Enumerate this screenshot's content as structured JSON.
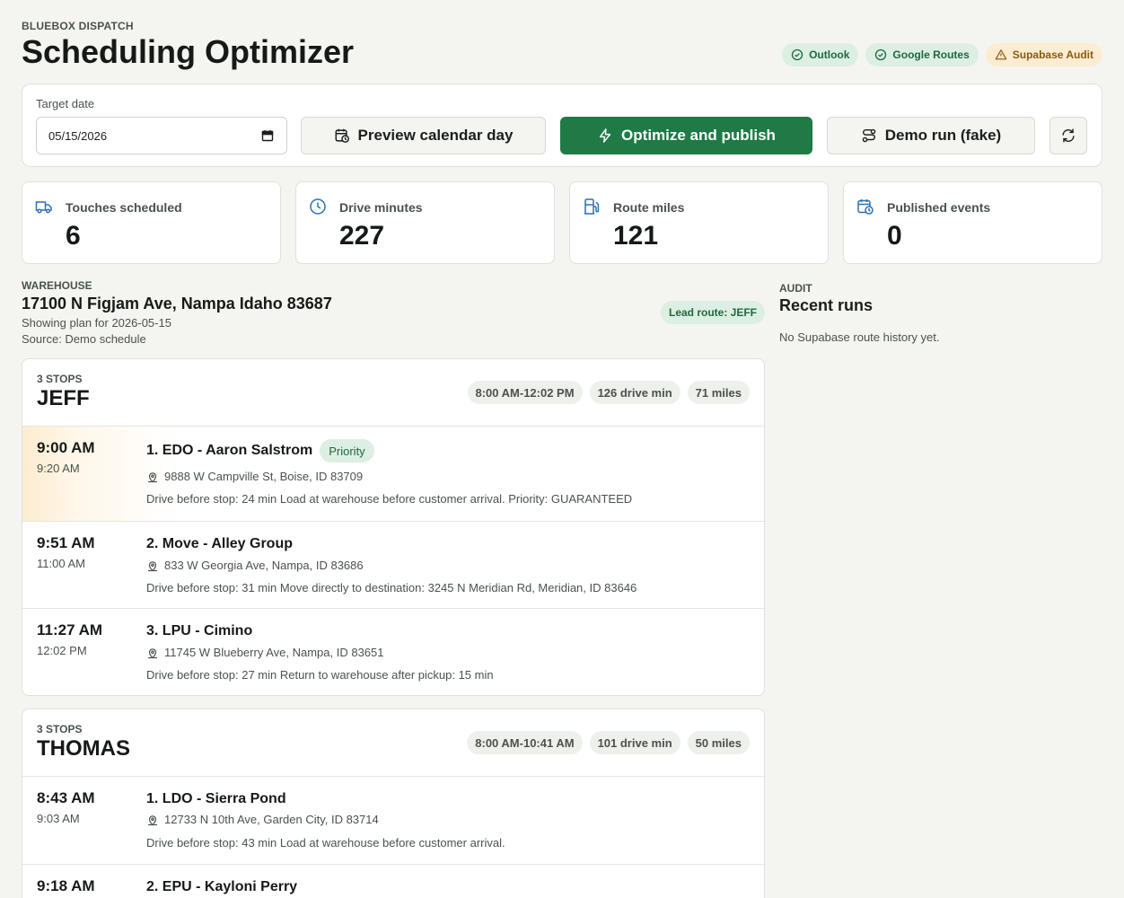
{
  "header": {
    "eyebrow": "BLUEBOX DISPATCH",
    "title": "Scheduling Optimizer",
    "badges": [
      {
        "label": "Outlook",
        "icon": "check-circle-icon"
      },
      {
        "label": "Google Routes",
        "icon": "check-circle-icon"
      },
      {
        "label": "Supabase Audit",
        "icon": "warning-icon"
      }
    ]
  },
  "controls": {
    "target_label": "Target date",
    "date_value": "05/15/2026",
    "preview_label": "Preview calendar day",
    "optimize_label": "Optimize and publish",
    "demo_label": "Demo run (fake)"
  },
  "stats": [
    {
      "label": "Touches scheduled",
      "value": "6",
      "icon": "truck-icon"
    },
    {
      "label": "Drive minutes",
      "value": "227",
      "icon": "clock-icon"
    },
    {
      "label": "Route miles",
      "value": "121",
      "icon": "fuel-icon"
    },
    {
      "label": "Published events",
      "value": "0",
      "icon": "calendar-clock-icon"
    }
  ],
  "warehouse": {
    "eyebrow": "WAREHOUSE",
    "address": "17100 N Figjam Ave, Nampa Idaho 83687",
    "plan": "Showing plan for 2026-05-15",
    "source": "Source: Demo schedule",
    "lead": "Lead route: JEFF"
  },
  "audit": {
    "eyebrow": "AUDIT",
    "title": "Recent runs",
    "empty": "No Supabase route history yet."
  },
  "routes": [
    {
      "stops_label": "3 STOPS",
      "name": "JEFF",
      "window": "8:00 AM-12:02 PM",
      "drive": "126 drive min",
      "miles": "71 miles",
      "stops": [
        {
          "time": "9:00 AM",
          "end": "9:20 AM",
          "title": "1. EDO - Aaron Salstrom",
          "priority": "Priority",
          "address": "9888 W Campville St, Boise, ID 83709",
          "note": "Drive before stop: 24 min Load at warehouse before customer arrival. Priority: GUARANTEED"
        },
        {
          "time": "9:51 AM",
          "end": "11:00 AM",
          "title": "2. Move - Alley Group",
          "address": "833 W Georgia Ave, Nampa, ID 83686",
          "note": "Drive before stop: 31 min Move directly to destination: 3245 N Meridian Rd, Meridian, ID 83646"
        },
        {
          "time": "11:27 AM",
          "end": "12:02 PM",
          "title": "3. LPU - Cimino",
          "address": "11745 W Blueberry Ave, Nampa, ID 83651",
          "note": "Drive before stop: 27 min Return to warehouse after pickup: 15 min"
        }
      ]
    },
    {
      "stops_label": "3 STOPS",
      "name": "THOMAS",
      "window": "8:00 AM-10:41 AM",
      "drive": "101 drive min",
      "miles": "50 miles",
      "stops": [
        {
          "time": "8:43 AM",
          "end": "9:03 AM",
          "title": "1. LDO - Sierra Pond",
          "address": "12733 N 10th Ave, Garden City, ID 83714",
          "note": "Drive before stop: 43 min Load at warehouse before customer arrival."
        },
        {
          "time": "9:18 AM",
          "title": "2. EPU - Kayloni Perry"
        }
      ]
    }
  ]
}
